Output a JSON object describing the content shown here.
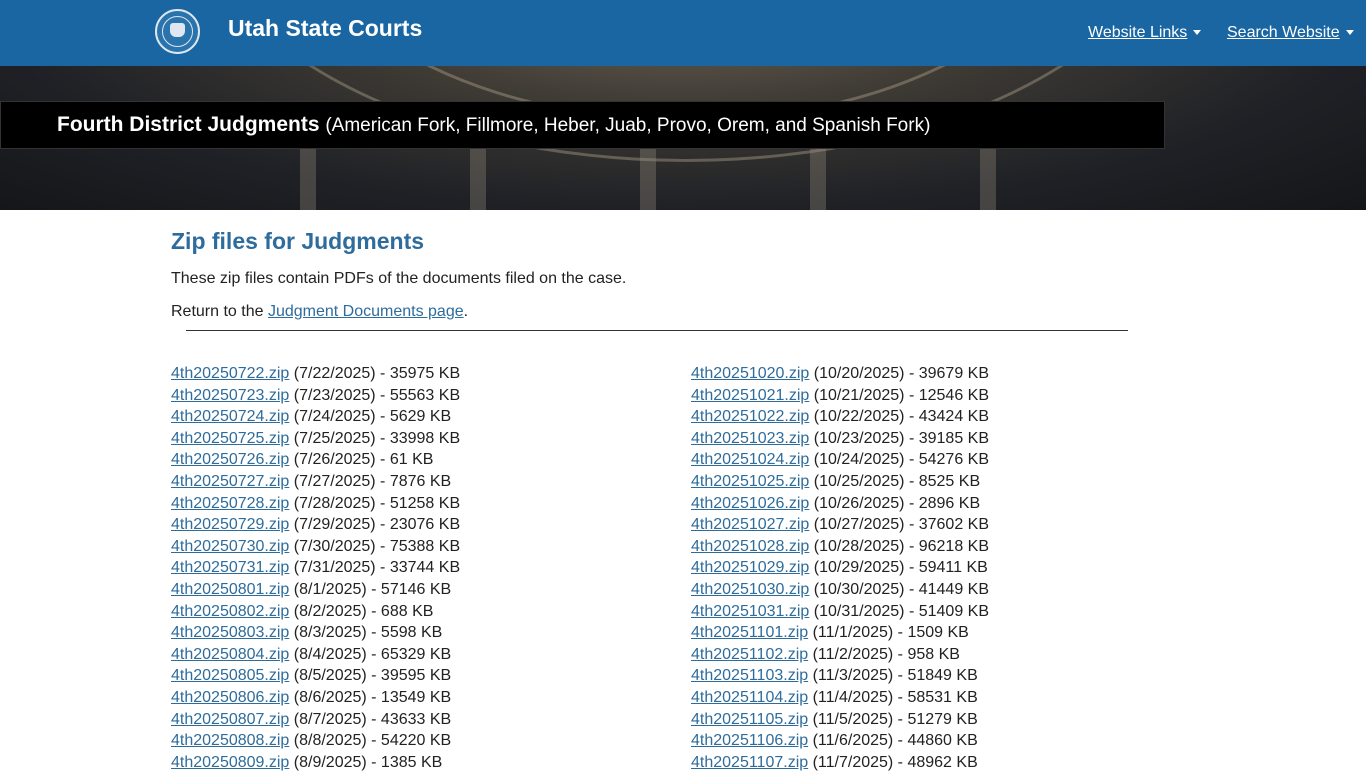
{
  "header": {
    "site_title": "Utah State Courts",
    "nav": [
      {
        "label": "Website Links"
      },
      {
        "label": "Search Website"
      }
    ]
  },
  "banner": {
    "title": "Fourth District Judgments",
    "subtitle": "(American Fork, Fillmore, Heber, Juab, Provo, Orem, and Spanish Fork)"
  },
  "main": {
    "heading": "Zip files for Judgments",
    "intro": "These zip files contain PDFs of the documents filed on the case.",
    "return_prefix": "Return to the ",
    "return_link": "Judgment Documents page",
    "return_suffix": "."
  },
  "files_left": [
    {
      "name": "4th20250722.zip",
      "meta": " (7/22/2025) - 35975 KB"
    },
    {
      "name": "4th20250723.zip",
      "meta": " (7/23/2025) - 55563 KB"
    },
    {
      "name": "4th20250724.zip",
      "meta": " (7/24/2025) - 5629 KB"
    },
    {
      "name": "4th20250725.zip",
      "meta": " (7/25/2025) - 33998 KB"
    },
    {
      "name": "4th20250726.zip",
      "meta": " (7/26/2025) - 61 KB"
    },
    {
      "name": "4th20250727.zip",
      "meta": " (7/27/2025) - 7876 KB"
    },
    {
      "name": "4th20250728.zip",
      "meta": " (7/28/2025) - 51258 KB"
    },
    {
      "name": "4th20250729.zip",
      "meta": " (7/29/2025) - 23076 KB"
    },
    {
      "name": "4th20250730.zip",
      "meta": " (7/30/2025) - 75388 KB"
    },
    {
      "name": "4th20250731.zip",
      "meta": " (7/31/2025) - 33744 KB"
    },
    {
      "name": "4th20250801.zip",
      "meta": " (8/1/2025) - 57146 KB"
    },
    {
      "name": "4th20250802.zip",
      "meta": " (8/2/2025) - 688 KB"
    },
    {
      "name": "4th20250803.zip",
      "meta": " (8/3/2025) - 5598 KB"
    },
    {
      "name": "4th20250804.zip",
      "meta": " (8/4/2025) - 65329 KB"
    },
    {
      "name": "4th20250805.zip",
      "meta": " (8/5/2025) - 39595 KB"
    },
    {
      "name": "4th20250806.zip",
      "meta": " (8/6/2025) - 13549 KB"
    },
    {
      "name": "4th20250807.zip",
      "meta": " (8/7/2025) - 43633 KB"
    },
    {
      "name": "4th20250808.zip",
      "meta": " (8/8/2025) - 54220 KB"
    },
    {
      "name": "4th20250809.zip",
      "meta": " (8/9/2025) - 1385 KB"
    }
  ],
  "files_right": [
    {
      "name": "4th20251020.zip",
      "meta": " (10/20/2025) - 39679 KB"
    },
    {
      "name": "4th20251021.zip",
      "meta": " (10/21/2025) - 12546 KB"
    },
    {
      "name": "4th20251022.zip",
      "meta": " (10/22/2025) - 43424 KB"
    },
    {
      "name": "4th20251023.zip",
      "meta": " (10/23/2025) - 39185 KB"
    },
    {
      "name": "4th20251024.zip",
      "meta": " (10/24/2025) - 54276 KB"
    },
    {
      "name": "4th20251025.zip",
      "meta": " (10/25/2025) - 8525 KB"
    },
    {
      "name": "4th20251026.zip",
      "meta": " (10/26/2025) - 2896 KB"
    },
    {
      "name": "4th20251027.zip",
      "meta": " (10/27/2025) - 37602 KB"
    },
    {
      "name": "4th20251028.zip",
      "meta": " (10/28/2025) - 96218 KB"
    },
    {
      "name": "4th20251029.zip",
      "meta": " (10/29/2025) - 59411 KB"
    },
    {
      "name": "4th20251030.zip",
      "meta": " (10/30/2025) - 41449 KB"
    },
    {
      "name": "4th20251031.zip",
      "meta": " (10/31/2025) - 51409 KB"
    },
    {
      "name": "4th20251101.zip",
      "meta": " (11/1/2025) - 1509 KB"
    },
    {
      "name": "4th20251102.zip",
      "meta": " (11/2/2025) - 958 KB"
    },
    {
      "name": "4th20251103.zip",
      "meta": " (11/3/2025) - 51849 KB"
    },
    {
      "name": "4th20251104.zip",
      "meta": " (11/4/2025) - 58531 KB"
    },
    {
      "name": "4th20251105.zip",
      "meta": " (11/5/2025) - 51279 KB"
    },
    {
      "name": "4th20251106.zip",
      "meta": " (11/6/2025) - 44860 KB"
    },
    {
      "name": "4th20251107.zip",
      "meta": " (11/7/2025) - 48962 KB"
    }
  ]
}
